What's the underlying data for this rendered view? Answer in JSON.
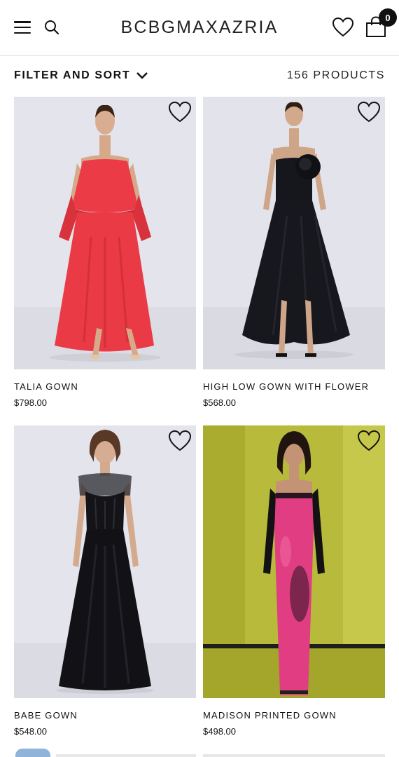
{
  "header": {
    "brand": "BCBGMAXAZRIA",
    "cart_count": "0",
    "icons": [
      "menu-icon",
      "search-icon",
      "heart-icon",
      "shopping-bag-icon"
    ]
  },
  "toolbar": {
    "filter_label": "FILTER AND SORT",
    "product_count": "156 PRODUCTS"
  },
  "products": [
    {
      "name": "TALIA GOWN",
      "price": "$798.00",
      "backdrop": "#e3e3ea",
      "dress": "#ea3a45"
    },
    {
      "name": "HIGH LOW GOWN WITH FLOWER",
      "price": "$568.00",
      "backdrop": "#e2e2ea",
      "dress": "#15151c"
    },
    {
      "name": "BABE GOWN",
      "price": "$548.00",
      "backdrop": "#e3e3ea",
      "dress": "#111114"
    },
    {
      "name": "MADISON PRINTED GOWN",
      "price": "$498.00",
      "backdrop": "#b6b93a",
      "dress": "#e03c82"
    }
  ]
}
